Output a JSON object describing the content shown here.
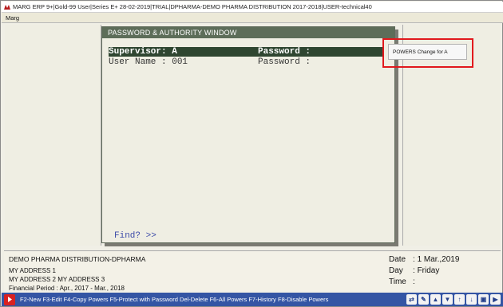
{
  "window": {
    "title": "MARG ERP 9+|Gold-99 User|Series E+ 28-02-2019|TRIAL|DPHARMA-DEMO PHARMA DISTRIBUTION 2017-2018|USER-technical40",
    "icon": "marg-logo-icon"
  },
  "menu": {
    "items": [
      "Marg"
    ]
  },
  "dialog": {
    "title": "PASSWORD & AUTHORITY WINDOW",
    "rows": [
      {
        "left": "Supervisor: A",
        "right": "Password :"
      },
      {
        "left": "User Name : 001",
        "right": "Password :"
      }
    ],
    "find_label": "Find? >>"
  },
  "popup": {
    "label": "POWERS Change for A"
  },
  "footer": {
    "company": "DEMO PHARMA DISTRIBUTION-DPHARMA",
    "address1": "MY ADDRESS 1",
    "address2": "MY ADDRESS 2 MY ADDRESS 3",
    "financial_period": "Financial Period : Apr., 2017 - Mar., 2018",
    "date_label": "Date",
    "date_value": "1 Mar.,2019",
    "day_label": "Day",
    "day_value": "Friday",
    "time_label": "Time",
    "time_value": ""
  },
  "statusbar": {
    "shortcuts": "F2-New F3-Edit F4-Copy Powers F5-Protect with Password Del-Delete F6-All Powers F7-History F8-Disable Powers",
    "icons": [
      "shuffle-icon",
      "edit-icon",
      "upload-icon",
      "download-icon",
      "up-arrow-icon",
      "down-arrow-icon",
      "printer-icon",
      "play-icon"
    ]
  },
  "colors": {
    "dialog_title_bg": "#5d6d59",
    "selected_row_bg": "#2f4631",
    "statusbar_bg": "#3455a4",
    "highlight_red": "#e1191d"
  }
}
